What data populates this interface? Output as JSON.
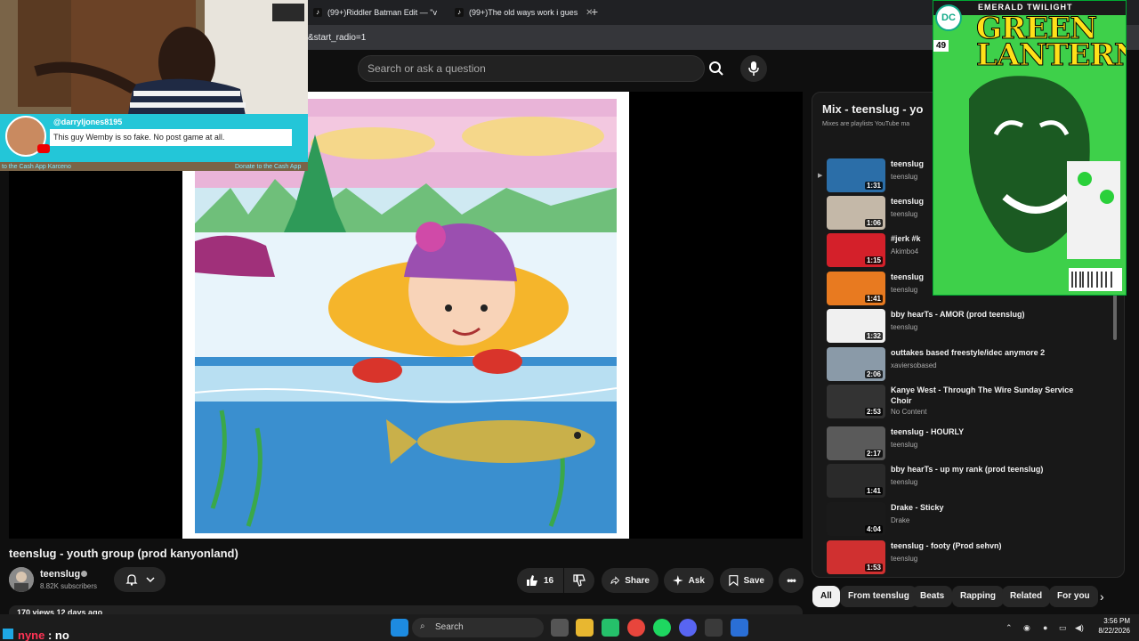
{
  "browser": {
    "tabs": [
      {
        "label": "(99+)Riddler Batman Edit — \"v"
      },
      {
        "label": "(99+)The old ways work i gues"
      }
    ],
    "url_fragment": "&start_radio=1"
  },
  "header": {
    "search_placeholder": "Search or ask a question"
  },
  "overlay": {
    "chat_user": "@darryljones8195",
    "chat_message": "This guy Wemby is so fake. No post game at all.",
    "donate_left": "to the Cash App Karceno",
    "donate_right": "Donate to the Cash App"
  },
  "video": {
    "title": "teenslug - youth group (prod kanyonland)",
    "channel": "teenslug",
    "subscribers": "8.82K subscribers",
    "likes": "16",
    "share": "Share",
    "ask": "Ask",
    "save": "Save",
    "views": "170 views  12 days ago"
  },
  "mix": {
    "title": "Mix - teenslug - yo",
    "subtitle": "Mixes are playlists YouTube ma",
    "items": [
      {
        "title": "teenslug",
        "channel": "teenslug",
        "duration": "1:31"
      },
      {
        "title": "teenslug",
        "channel": "teenslug",
        "duration": "1:06"
      },
      {
        "title": "#jerk #k",
        "channel": "Akimbo4",
        "duration": "1:15"
      },
      {
        "title": "teenslug",
        "channel": "teenslug",
        "duration": "1:41"
      },
      {
        "title": "bby hearTs - AMOR (prod teenslug)",
        "channel": "teenslug",
        "duration": "1:32"
      },
      {
        "title": "outtakes based freestyle/idec anymore 2",
        "channel": "xaviersobased",
        "duration": "2:06"
      },
      {
        "title": "Kanye West - Through The Wire Sunday Service Choir",
        "channel": "No Content",
        "duration": "2:53"
      },
      {
        "title": "teenslug - HOURLY",
        "channel": "teenslug",
        "duration": "2:17"
      },
      {
        "title": "bby hearTs - up my rank (prod teenslug)",
        "channel": "teenslug",
        "duration": "1:41"
      },
      {
        "title": "Drake - Sticky",
        "channel": "Drake",
        "duration": "4:04"
      },
      {
        "title": "teenslug - footy (Prod sehvn)",
        "channel": "teenslug",
        "duration": "1:53"
      }
    ]
  },
  "chips": [
    "All",
    "From teenslug",
    "Beats",
    "Rapping",
    "Related",
    "For you"
  ],
  "comic": {
    "top": "EMERALD TWILIGHT",
    "logo_line1": "GREEN",
    "logo_line2": "LANTERN",
    "issue": "49"
  },
  "taskbar": {
    "stream_name": "nyne",
    "stream_text": ": no",
    "search": "Search",
    "time": "3:56 PM",
    "date": "8/22/2026"
  },
  "colors": {
    "background": "#0f0f0f",
    "chat_accent": "#23c6d8",
    "comic_green": "#2cc43a"
  }
}
